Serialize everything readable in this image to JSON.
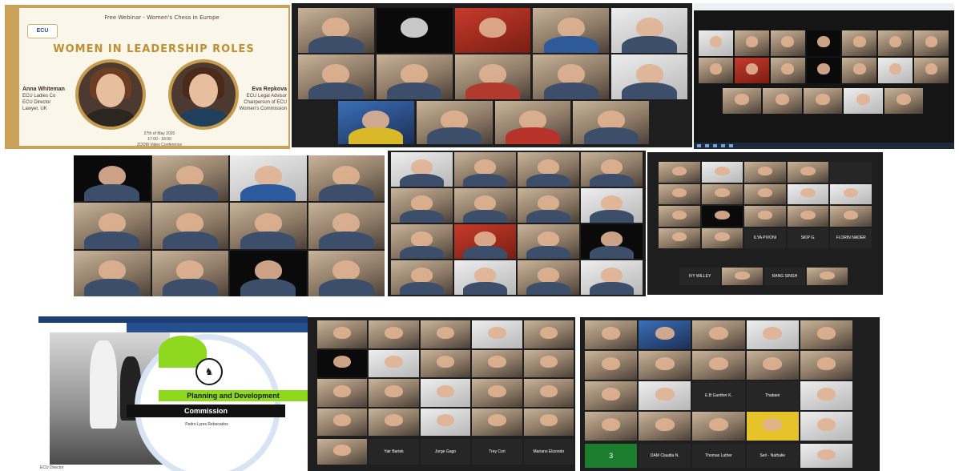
{
  "poster": {
    "logo_text": "ECU",
    "series": "Free Webinar - Women's Chess in Europe",
    "title": "WOMEN IN LEADERSHIP ROLES",
    "speaker_left_name": "Anna Whiteman",
    "speaker_left_lines": [
      "ECU Ladies Co",
      "ECU Director",
      "Lawyer, UK"
    ],
    "speaker_right_name": "Eva Repkova",
    "speaker_right_lines": [
      "ECU Legal Advisor",
      "Chairperson of ECU",
      "Women's Commission"
    ],
    "date_lines": [
      "27th of May 2020",
      "17:00 - 18:00",
      "ZOOM Video Conference"
    ]
  },
  "slide": {
    "icon": "fide-logo-icon",
    "heading_1": "Planning and Development",
    "heading_2": "Commission",
    "presenter": "Pedro Lyres Rebocados",
    "pip_name": "ECU Director"
  },
  "grid_labels": {
    "grid6": [
      "ILYA PIVONI",
      "SKIP G.",
      "FLORIN NADER",
      "IVY WILLEY",
      "RANG SINGH"
    ],
    "grid8": [
      "Yair Bartek",
      "Jorge Gago",
      "Trey Cori",
      "Mariano Elizondo"
    ],
    "grid9": [
      "E.B Gunther K.",
      "Thabani",
      "DAM Claudia N.",
      "Thomas Luther",
      "Serl - Nathalie"
    ]
  },
  "colors": {
    "poster_gold": "#caa159",
    "poster_title": "#c08f34",
    "zoom_dark": "#1e1e1e",
    "slide_green": "#8ed81f",
    "slide_blue": "#1b3e73"
  }
}
